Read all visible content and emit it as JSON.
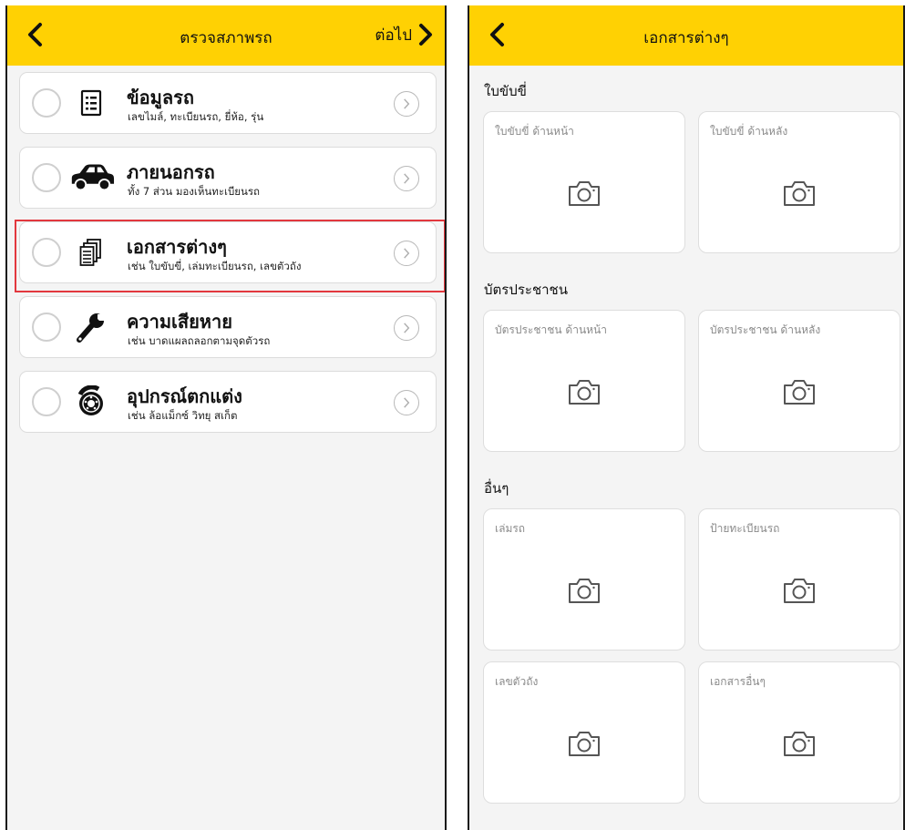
{
  "left_screen": {
    "header": {
      "title": "ตรวจสภาพรถ",
      "next_label": "ต่อไป"
    },
    "items": [
      {
        "title": "ข้อมูลรถ",
        "subtitle": "เลขไมล์, ทะเบียนรถ, ยี่ห้อ, รุ่น",
        "icon": "list-document-icon",
        "selected": false
      },
      {
        "title": "ภายนอกรถ",
        "subtitle": "ทั้ง 7 ส่วน มองเห็นทะเบียนรถ",
        "icon": "car-icon",
        "selected": false
      },
      {
        "title": "เอกสารต่างๆ",
        "subtitle": "เช่น ใบขับขี่, เล่มทะเบียนรถ, เลขตัวถัง",
        "icon": "documents-icon",
        "selected": false,
        "highlighted": true
      },
      {
        "title": "ความเสียหาย",
        "subtitle": "เช่น บาดแผลถลอกตามจุดตัวรถ",
        "icon": "wrench-icon",
        "selected": false
      },
      {
        "title": "อุปกรณ์ตกแต่ง",
        "subtitle": "เช่น ล้อแม็กซ์ วิทยุ สเก็ต",
        "icon": "brake-disc-icon",
        "selected": false
      }
    ]
  },
  "right_screen": {
    "header": {
      "title": "เอกสารต่างๆ"
    },
    "sections": [
      {
        "title": "ใบขับขี่",
        "cards": [
          {
            "label": "ใบขับขี่ ด้านหน้า"
          },
          {
            "label": "ใบขับขี่ ด้านหลัง"
          }
        ]
      },
      {
        "title": "บัตรประชาชน",
        "cards": [
          {
            "label": "บัตรประชาชน ด้านหน้า"
          },
          {
            "label": "บัตรประชาชน ด้านหลัง"
          }
        ]
      },
      {
        "title": "อื่นๆ",
        "cards": [
          {
            "label": "เล่มรถ"
          },
          {
            "label": "ป้ายทะเบียนรถ"
          },
          {
            "label": "เลขตัวถัง"
          },
          {
            "label": "เอกสารอื่นๆ"
          }
        ]
      }
    ]
  },
  "colors": {
    "header_bg": "#ffd103",
    "highlight": "#e2383e",
    "background": "#f4f4f4"
  }
}
